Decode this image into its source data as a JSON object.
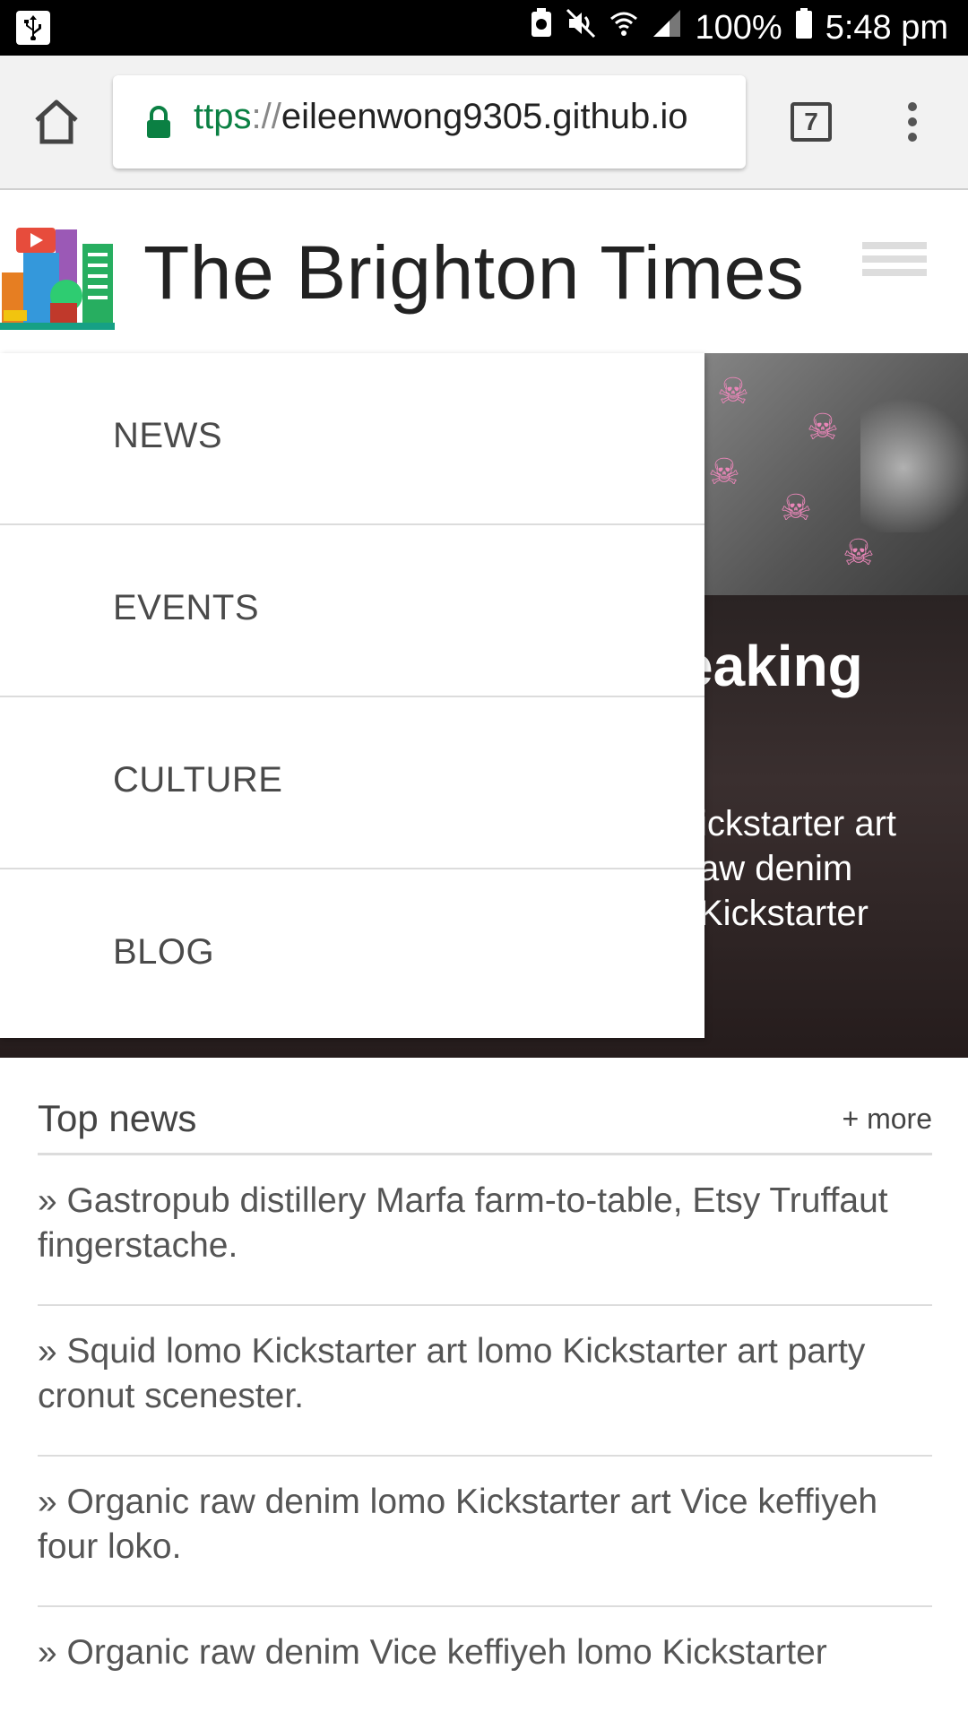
{
  "status_bar": {
    "battery": "100%",
    "time": "5:48 pm"
  },
  "browser": {
    "url_scheme": "ttps",
    "url_sep": "://",
    "url_host": "eileenwong9305.github.io",
    "tab_count": "7"
  },
  "site": {
    "title": "The Brighton Times"
  },
  "drawer": {
    "items": [
      "NEWS",
      "EVENTS",
      "CULTURE",
      "BLOG"
    ]
  },
  "hero": {
    "headline_fragment": "eaking",
    "body_lines": [
      "ickstarter art",
      "aw denim",
      "Kickstarter"
    ]
  },
  "top_news": {
    "title": "Top news",
    "more": "+ more",
    "items": [
      "» Gastropub distillery Marfa farm-to-table, Etsy Truffaut fingerstache.",
      "» Squid lomo Kickstarter art lomo Kickstarter art party cronut scenester.",
      "» Organic raw denim lomo Kickstarter art Vice keffiyeh four loko.",
      "» Organic raw denim Vice keffiyeh lomo Kickstarter"
    ]
  },
  "colors": {
    "secure_green": "#0b8043",
    "chrome_bg": "#f2f2f2"
  }
}
